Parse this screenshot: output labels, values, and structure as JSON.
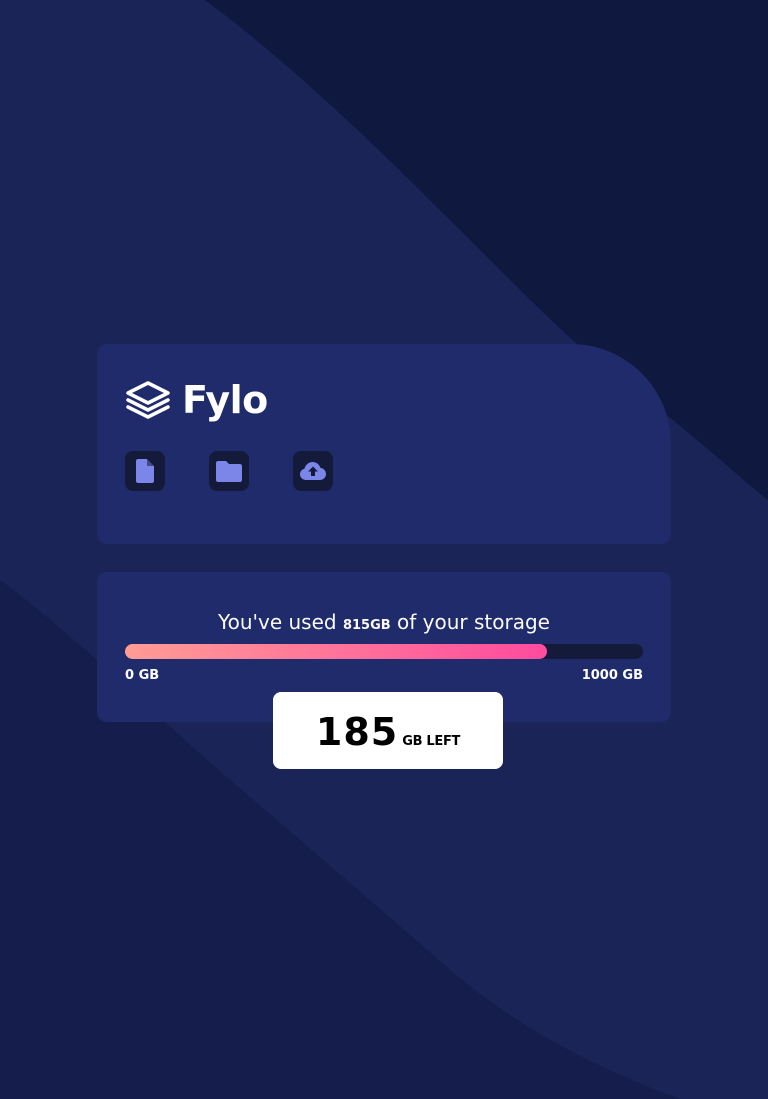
{
  "app": {
    "logo_text": "Fylo",
    "logo_icon": "stacked-layers-icon"
  },
  "toolbar": {
    "icons": [
      {
        "name": "document-icon"
      },
      {
        "name": "folder-icon"
      },
      {
        "name": "cloud-upload-icon"
      }
    ]
  },
  "storage": {
    "prefix": "You've used ",
    "used_amount": "815GB",
    "suffix": " of your storage",
    "scale_min_label": "0 GB",
    "scale_max_label": "1000 GB",
    "used_fraction": 0.815,
    "left_number": "185",
    "left_unit": "GB LEFT"
  },
  "colors": {
    "background": "#131d4a",
    "card": "#1f2b6b",
    "icon_bg": "#141a3a",
    "icon_fill": "#7b86e8",
    "gradient_start": "#ff9c95",
    "gradient_end": "#ff4b9e"
  }
}
